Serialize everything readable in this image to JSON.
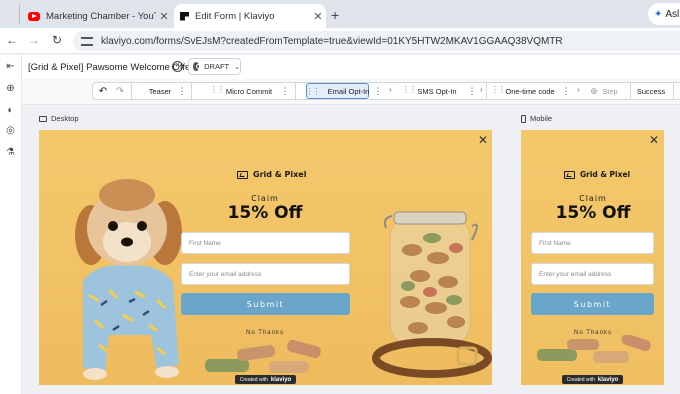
{
  "browser": {
    "tabs": [
      {
        "title": "Marketing Chamber - YouTube",
        "favicon": "youtube-icon",
        "active": false
      },
      {
        "title": "Edit Form | Klaviyo",
        "favicon": "klaviyo-icon",
        "active": true
      }
    ],
    "new_tab": "+",
    "close_glyph": "✕",
    "profile_label": "Asl",
    "url": "klaviyo.com/forms/SvEJsM?createdFromTemplate=true&viewId=01KY5HTW2MKAV1GGAAQ38VQMTR",
    "nav": {
      "back": "←",
      "forward": "→",
      "reload": "↻"
    }
  },
  "editor": {
    "form_name": "[Grid & Pixel] Pawsome Welcome Offer",
    "status": "DRAFT",
    "history": {
      "undo": "↶",
      "redo": "↷"
    },
    "steps": [
      "Teaser",
      "Micro Commit",
      "Email Opt-In",
      "SMS Opt-In",
      "One-time code",
      "Step",
      "Success"
    ],
    "selected_step": "Email Opt-In",
    "more_glyph": "⋮",
    "grip_glyph": "⋮⋮",
    "chevron_glyph": "›",
    "add_step_glyph": "⊕",
    "sidebar_icons": [
      "exit-icon",
      "add-icon",
      "palette-icon",
      "targeting-icon",
      "test-icon"
    ]
  },
  "preview": {
    "desktop_label": "Desktop",
    "mobile_label": "Mobile",
    "brand": "Grid & Pixel",
    "claim": "Claim",
    "offer": "15% Off",
    "first_name_placeholder": "First Name",
    "email_placeholder": "Enter your email address",
    "submit": "Submit",
    "no_thanks": "No Thanks",
    "credit_prefix": "Created with",
    "credit_brand": "klaviyo",
    "close": "✕"
  },
  "colors": {
    "popup_bg": "#f1c165",
    "submit_bg": "#6aa6c9",
    "selected_step_bg": "#e4eefa",
    "selected_step_border": "#5a8ed1"
  }
}
